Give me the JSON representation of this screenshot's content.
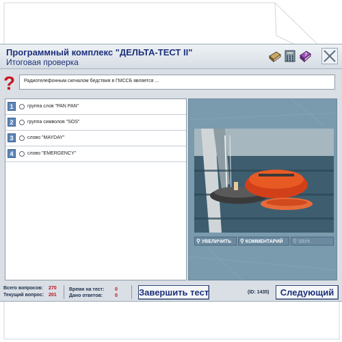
{
  "header": {
    "title": "Программный комплекс \"ДЕЛЬТА-ТЕСТ II\"",
    "subtitle": "Итоговая проверка",
    "tools": [
      "book-icon",
      "calculator-icon",
      "help-book-icon"
    ],
    "close_icon": "close-icon"
  },
  "question": {
    "icon": "question-mark-icon",
    "text": "Радиотелефонным сигналом бедствия в ГМССБ является ..."
  },
  "answers": [
    {
      "num": "1",
      "text": "группа слов \"PAN PAN\""
    },
    {
      "num": "2",
      "text": "группа символов \"SOS\""
    },
    {
      "num": "3",
      "text": "слово \"MAYDAY\""
    },
    {
      "num": "4",
      "text": "слово \"EMERGENCY\""
    }
  ],
  "media": {
    "zoom_label": "УВЕЛИЧИТЬ",
    "comment_label": "КОММЕНТАРИЙ",
    "sound_label": "ЗВУК"
  },
  "footer": {
    "total_label": "Всего вопросов:",
    "total_value": "270",
    "current_label": "Текущий вопрос:",
    "current_value": "201",
    "time_label": "Время на тест:",
    "time_value": "0",
    "answered_label": "Дано ответов:",
    "answered_value": "0",
    "finish_label": "Завершить тест",
    "id_text": "(ID: 1435)",
    "next_label": "Следующий"
  },
  "colors": {
    "title": "#1b2f7a",
    "stat_value": "#c0101a",
    "panel": "#7a9aae"
  }
}
